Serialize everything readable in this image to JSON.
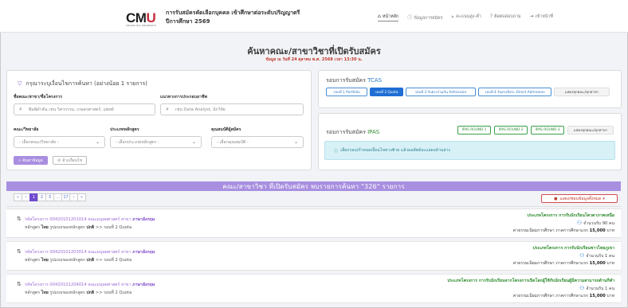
{
  "header": {
    "logo_main": "CMU",
    "logo_sub": "CHIANG MAI UNIVERSITY",
    "title": "การรับสมัครคัดเลือกบุคคล เข้าศึกษาต่อระดับปริญญาตรี",
    "year": "ปีการศึกษา 2569",
    "nav": [
      {
        "icon": "home-icon",
        "glyph": "⌂",
        "label": "หน้าหลัก"
      },
      {
        "icon": "info-icon",
        "glyph": "ⓘ",
        "label": "ข้อมูลการสมัคร"
      },
      {
        "icon": "chart-icon",
        "glyph": "⟀",
        "label": "คะแนนสูง-ต่ำ"
      },
      {
        "icon": "question-icon",
        "glyph": "?",
        "label": "ติดต่อสอบถาม"
      },
      {
        "icon": "login-icon",
        "glyph": "⇥",
        "label": "เข้าหน้าที่"
      }
    ]
  },
  "page": {
    "title": "ค้นหาคณะ/สาขาวิชาที่เปิดรับสมัคร",
    "subtitle": "ข้อมูล ณ วันที่ 24 ตุลาคม พ.ศ. 2568 เวลา 13:30 น."
  },
  "filter": {
    "hint": "กรุณาระบุเงื่อนไขการค้นหา (อย่างน้อย 1 รายการ)",
    "name_label": "ชื่อคณะ/สาขา/ชื่อโครงการ",
    "name_placeholder": "พิมพ์คำค้น เช่น วิศวกรรม, เกษตรศาสตร์, แพทย์",
    "career_label": "แนวทางการประกอบอาชีพ",
    "career_placeholder": "เช่น Data Analyst, นักวิจัย",
    "faculty_label": "คณะ/วิทยาลัย",
    "faculty_value": "- เลือกคณะ/วิทยาลัย -",
    "type_label": "ประเภทหลักสูตร",
    "type_value": "- เลือกประเภทหลักสูตร -",
    "qual_label": "คุณสมบัติผู้สมัคร",
    "qual_value": "- เลือกคุณสมบัติ -",
    "search_button": "ค้นหาข้อมูล",
    "clear_button": "ล้างเงื่อนไข"
  },
  "tcas": {
    "title_prefix": "รอบการรับสมัคร",
    "title_highlight": "TCAS",
    "buttons": [
      "รอบที่ 1 Portfolio",
      "รอบที่ 2 Quota",
      "รอบที่ 3 รับตรงร่วมกัน Admission",
      "รอบที่ 4 รับตรงอิสระ Direct Admission",
      "แสดงทุกคณะ/ทุกสาขา"
    ]
  },
  "ipas": {
    "title_prefix": "รอบการรับสมัคร",
    "title_highlight": "IPAS",
    "buttons": [
      "IPAS ROUND 1",
      "IPAS ROUND 2",
      "IPAS ROUND 3",
      "แสดงทุกคณะ/ทุกสาขา"
    ],
    "alert": "เลือกรอบ/กำหนดเงื่อนไขทางซ้าย แล้วผลลัพธ์จะแสดงด้านล่าง"
  },
  "results": {
    "summary": "คณะ/สาขาวิชา ที่เปิดรับสมัคร พบรายการค้นหา \"326\" รายการ",
    "pager": [
      "«",
      "‹",
      "1",
      "2",
      "3",
      "…",
      "17",
      "›",
      "»"
    ],
    "current_page": "1",
    "show_all": "แสดง/ซ่อนข้อมูลทั้งหมด",
    "rows": [
      {
        "code_text": "รหัสโครงการ 00420101201014 คณะมนุษยศาสตร์ สาขา",
        "major": "ภาษาอังกฤษ",
        "curr_prefix": "หลักสูตร",
        "curr_lang": "ไทย",
        "curr_mid": "รูปแบบของหลักสูตร",
        "curr_type": "ปกติ",
        "round": ">> รอบที่ 2 Quota",
        "project_type": "ประเภทโครงการ การรับนักเรียนโควตาภาคเหนือ",
        "seats": "จำนวนรับ 90 คน",
        "fee_label": "ค่าธรรมเนียมการศึกษา ภาคการศึกษาแรก",
        "fee": "15,000",
        "fee_unit": "บาท"
      },
      {
        "code_text": "รหัสโครงการ 00420101203014 คณะมนุษยศาสตร์ สาขา",
        "major": "ภาษาอังกฤษ",
        "curr_prefix": "หลักสูตร",
        "curr_lang": "ไทย",
        "curr_mid": "รูปแบบของหลักสูตร",
        "curr_type": "ปกติ",
        "round": ">> รอบที่ 2 Quota",
        "project_type": "ประเภทโครงการ การรับนักเรียนชาวไทยภูเขา",
        "seats": "จำนวนรับ 1 คน",
        "fee_label": "ค่าธรรมเนียมการศึกษา ภาคการศึกษาแรก",
        "fee": "15,000",
        "fee_unit": "บาท"
      },
      {
        "code_text": "รหัสโครงการ 00420101204014 คณะมนุษยศาสตร์ สาขา",
        "major": "ภาษาอังกฤษ",
        "curr_prefix": "หลักสูตร",
        "curr_lang": "ไทย",
        "curr_mid": "รูปแบบของหลักสูตร",
        "curr_type": "ปกติ",
        "round": ">> รอบที่ 2 Quota",
        "project_type": "ประเภทโครงการ การรับนักเรียนจากโครงการเปิดโลกผู้ใช้กับนักเรียนผู้มีความสามารถด้านกีฬา",
        "seats": "จำนวนรับ 1 คน",
        "fee_label": "ค่าธรรมเนียมการศึกษา ภาคการศึกษาแรก",
        "fee": "15,000",
        "fee_unit": "บาท"
      }
    ]
  },
  "colors": {
    "purple": "#a88fe0",
    "blue": "#1f6ed4",
    "green": "#2e8b2e",
    "red": "#c0392b"
  }
}
